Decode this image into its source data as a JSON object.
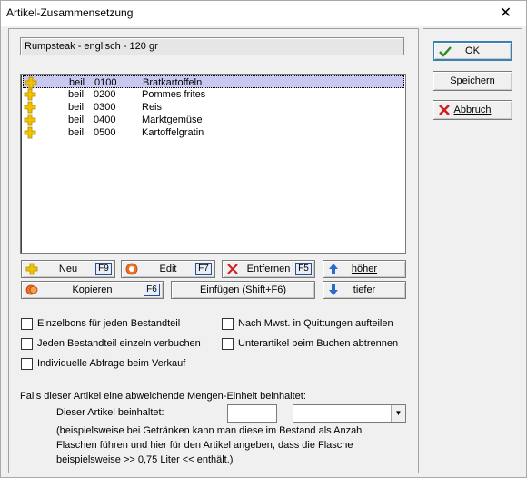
{
  "window": {
    "title": "Artikel-Zusammensetzung",
    "close_glyph": "✕"
  },
  "article": {
    "name": "Rumpsteak - englisch - 120 gr"
  },
  "components": [
    {
      "type": "beil",
      "code": "0100",
      "name": "Bratkartoffeln",
      "selected": true
    },
    {
      "type": "beil",
      "code": "0200",
      "name": "Pommes frites",
      "selected": false
    },
    {
      "type": "beil",
      "code": "0300",
      "name": "Reis",
      "selected": false
    },
    {
      "type": "beil",
      "code": "0400",
      "name": "Marktgemüse",
      "selected": false
    },
    {
      "type": "beil",
      "code": "0500",
      "name": "Kartoffelgratin",
      "selected": false
    }
  ],
  "actions": {
    "new": {
      "label": "Neu",
      "key": "F9",
      "icon": "plus-icon"
    },
    "edit": {
      "label": "Edit",
      "key": "F7",
      "icon": "lifebuoy-icon"
    },
    "remove": {
      "label": "Entfernen",
      "key": "F5",
      "icon": "cross-icon"
    },
    "up": {
      "label": "höher",
      "icon": "arrow-up-icon"
    },
    "copy": {
      "label": "Kopieren",
      "key": "F6",
      "icon": "copy-icon"
    },
    "insert": {
      "label": "Einfügen (Shift+F6)"
    },
    "down": {
      "label": "tiefer",
      "icon": "arrow-down-icon"
    }
  },
  "options": {
    "einzelbons": {
      "label": "Einzelbons für jeden Bestandteil",
      "checked": false
    },
    "mwst": {
      "label": "Nach Mwst. in Quittungen aufteilen",
      "checked": false
    },
    "einzeln": {
      "label": "Jeden Bestandteil einzeln verbuchen",
      "checked": false
    },
    "unterartikel": {
      "label": "Unterartikel beim Buchen abtrennen",
      "checked": false
    },
    "abfrage": {
      "label": "Individuelle Abfrage beim Verkauf",
      "checked": false
    }
  },
  "unit": {
    "intro": "Falls dieser Artikel eine abweichende Mengen-Einheit beinhaltet:",
    "label": "Dieser Artikel beinhaltet:",
    "quantity_value": "",
    "unit_value": "",
    "hint_line1": "(beispielsweise bei Getränken kann man diese im Bestand als Anzahl",
    "hint_line2": "Flaschen führen und hier für den Artikel angeben, dass die Flasche",
    "hint_line3": "beispielsweise >> 0,75 Liter << enthält.)"
  },
  "dialog_buttons": {
    "ok": {
      "label": "OK",
      "icon": "checkmark-icon"
    },
    "save": {
      "label": "Speichern"
    },
    "cancel": {
      "label": "Abbruch",
      "icon": "cancel-x-icon"
    }
  },
  "colors": {
    "selection": "#c8c8f0",
    "plus_icon": "#f2c200",
    "ok_check": "#2a8a2a",
    "cancel_x": "#d02020",
    "arrow_blue": "#2a6ac8",
    "key_border": "#2a4d8f"
  }
}
